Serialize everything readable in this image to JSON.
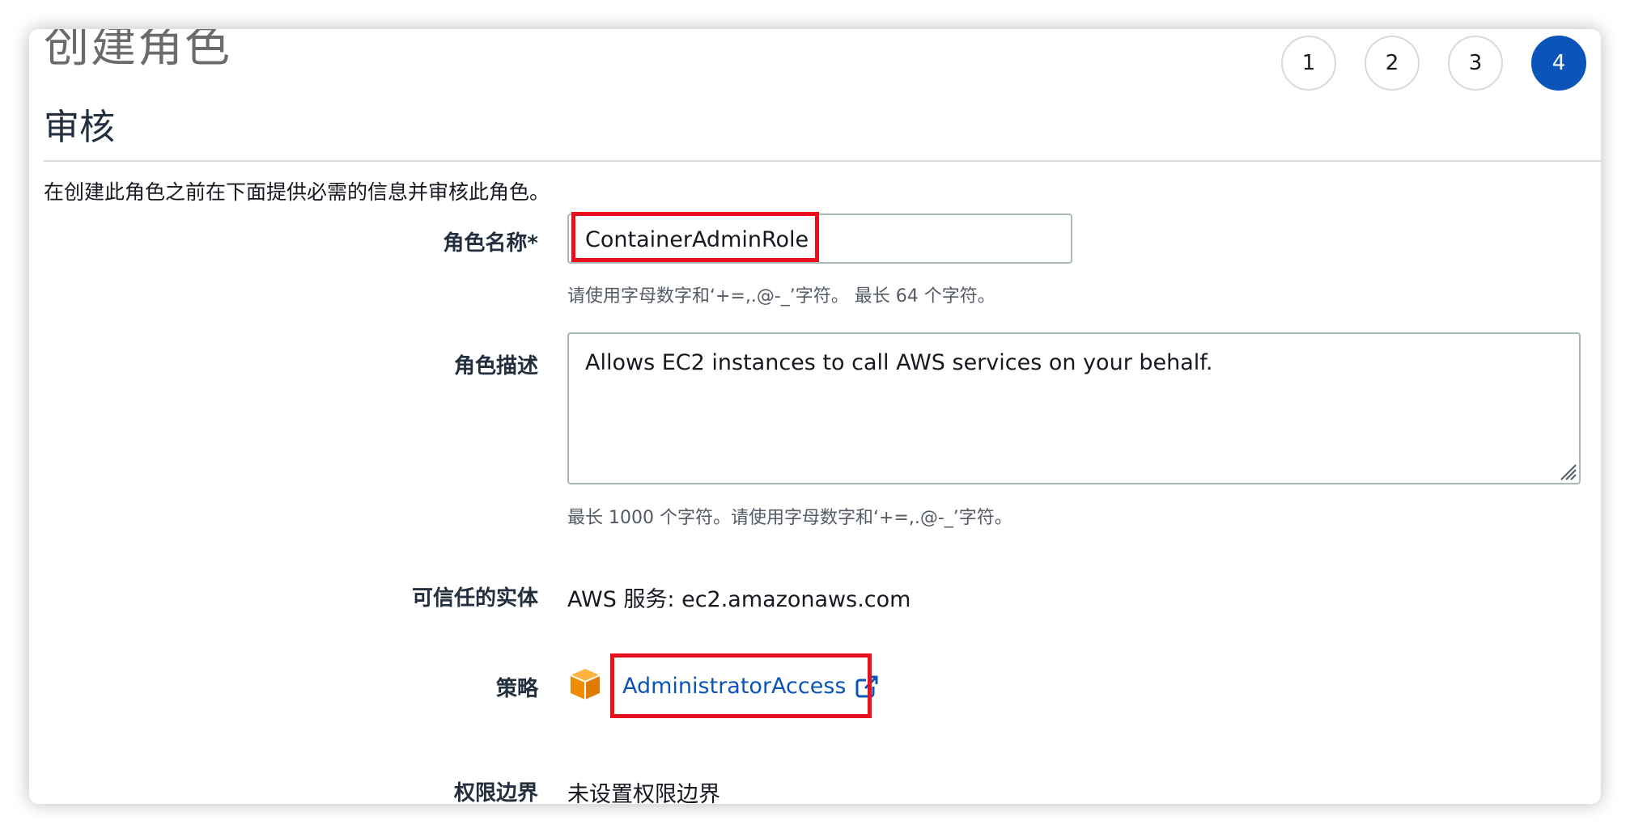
{
  "page": {
    "title": "创建角色",
    "steps": [
      "1",
      "2",
      "3",
      "4"
    ],
    "active_step": "4"
  },
  "review": {
    "section_title": "审核",
    "intro": "在创建此角色之前在下面提供必需的信息并审核此角色。"
  },
  "form": {
    "role_name": {
      "label": "角色名称*",
      "value": "ContainerAdminRole",
      "hint": "请使用字母数字和‘+=,.@-_’字符。 最长 64 个字符。"
    },
    "role_description": {
      "label": "角色描述",
      "value": "Allows EC2 instances to call AWS services on your behalf.",
      "hint": "最长 1000 个字符。请使用字母数字和‘+=,.@-_’字符。"
    },
    "trusted_entity": {
      "label": "可信任的实体",
      "value": "AWS 服务: ec2.amazonaws.com"
    },
    "policy": {
      "label": "策略",
      "link_text": "AdministratorAccess",
      "icon": "aws-managed-policy-cube-icon"
    },
    "permissions_boundary": {
      "label": "权限边界",
      "value": "未设置权限边界"
    }
  },
  "colors": {
    "accent": "#0b54ba",
    "highlight": "#e8101d",
    "policy_icon": "#f08c00"
  }
}
